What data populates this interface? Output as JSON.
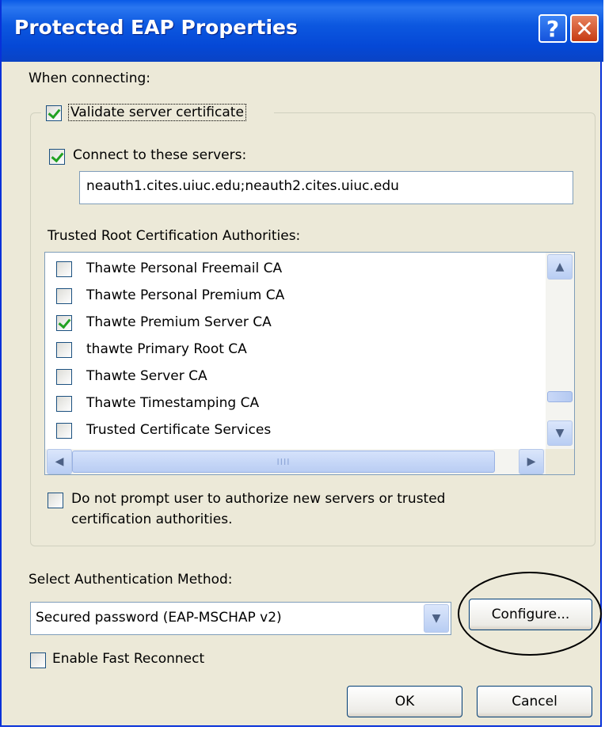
{
  "window": {
    "title": "Protected EAP Properties",
    "help_label": "?",
    "close_label": "✕"
  },
  "when_connecting": "When connecting:",
  "validate_cert": {
    "label": "Validate server certificate",
    "checked": true
  },
  "connect_servers": {
    "label": "Connect to these servers:",
    "checked": true,
    "value": "neauth1.cites.uiuc.edu;neauth2.cites.uiuc.edu"
  },
  "trusted_root_label": "Trusted Root Certification Authorities:",
  "ca_list": [
    {
      "label": "Thawte Personal Freemail CA",
      "checked": false
    },
    {
      "label": "Thawte Personal Premium CA",
      "checked": false
    },
    {
      "label": "Thawte Premium Server CA",
      "checked": true
    },
    {
      "label": "thawte Primary Root CA",
      "checked": false
    },
    {
      "label": "Thawte Server CA",
      "checked": false
    },
    {
      "label": "Thawte Timestamping CA",
      "checked": false
    },
    {
      "label": "Trusted Certificate Services",
      "checked": false
    }
  ],
  "scroll": {
    "up": "▲",
    "down": "▼",
    "left": "◀",
    "right": "▶",
    "grip": "IIII"
  },
  "do_not_prompt": {
    "line1": "Do not prompt user to authorize new servers or trusted",
    "line2": "certification authorities.",
    "checked": false
  },
  "auth_method_label": "Select Authentication Method:",
  "auth_method_value": "Secured password (EAP-MSCHAP v2)",
  "configure_label": "Configure...",
  "fast_reconnect": {
    "label": "Enable Fast Reconnect",
    "checked": false
  },
  "ok_label": "OK",
  "cancel_label": "Cancel",
  "colors": {
    "titlebar": "#0548d6",
    "dialog_bg": "#ece9d8",
    "check": "#21a121"
  }
}
